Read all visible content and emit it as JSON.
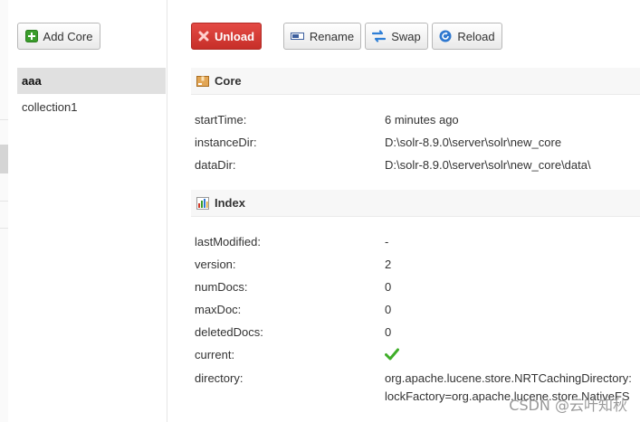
{
  "sidebar": {
    "add_core_label": "Add Core",
    "cores": [
      {
        "label": "aaa",
        "active": true
      },
      {
        "label": "collection1",
        "active": false
      }
    ]
  },
  "toolbar": {
    "unload_label": "Unload",
    "rename_label": "Rename",
    "swap_label": "Swap",
    "reload_label": "Reload"
  },
  "core_section": {
    "title": "Core",
    "rows": [
      {
        "key": "startTime:",
        "value": "6 minutes ago"
      },
      {
        "key": "instanceDir:",
        "value": "D:\\solr-8.9.0\\server\\solr\\new_core"
      },
      {
        "key": "dataDir:",
        "value": "D:\\solr-8.9.0\\server\\solr\\new_core\\data\\"
      }
    ]
  },
  "index_section": {
    "title": "Index",
    "rows": [
      {
        "key": "lastModified:",
        "value": "-"
      },
      {
        "key": "version:",
        "value": "2"
      },
      {
        "key": "numDocs:",
        "value": "0"
      },
      {
        "key": "maxDoc:",
        "value": "0"
      },
      {
        "key": "deletedDocs:",
        "value": "0"
      },
      {
        "key": "current:",
        "value": "",
        "icon": "checkmark-icon"
      },
      {
        "key": "directory:",
        "value": "org.apache.lucene.store.NRTCachingDirectory:",
        "value2": "lockFactory=org.apache.lucene.store.NativeFS"
      }
    ]
  },
  "watermark": "CSDN @云叶知秋",
  "colors": {
    "unload_bg": "#d73a35",
    "active_core_bg": "#e0e0e0",
    "check_green": "#3fae29"
  }
}
